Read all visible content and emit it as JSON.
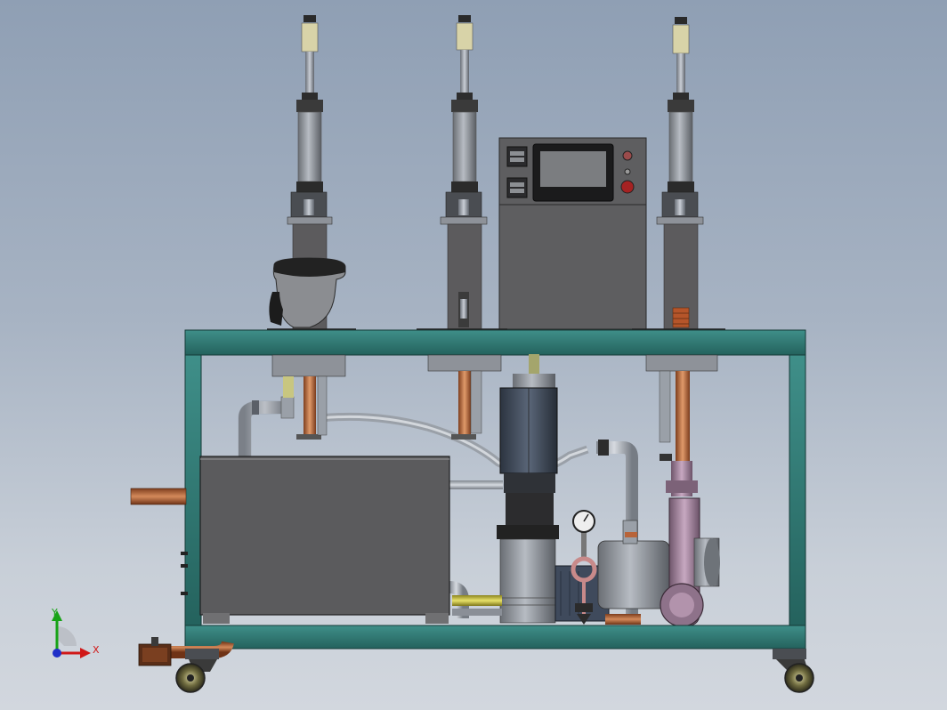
{
  "triad": {
    "x_label": "X",
    "y_label": "Y"
  },
  "colors": {
    "background_top": "#8f9fb4",
    "background_bottom": "#d2d7de",
    "frame": "#2f7a74",
    "frame_edge": "#1d4d49",
    "panel_gray": "#5d5d5f",
    "pipe_gray": "#aeb4bd",
    "copper": "#b86a3c",
    "motor_blue": "#3b4656",
    "blower_pink": "#9a7a94",
    "axis_x": "#d01818",
    "axis_y": "#17a317",
    "axis_z": "#1f2fc8"
  }
}
